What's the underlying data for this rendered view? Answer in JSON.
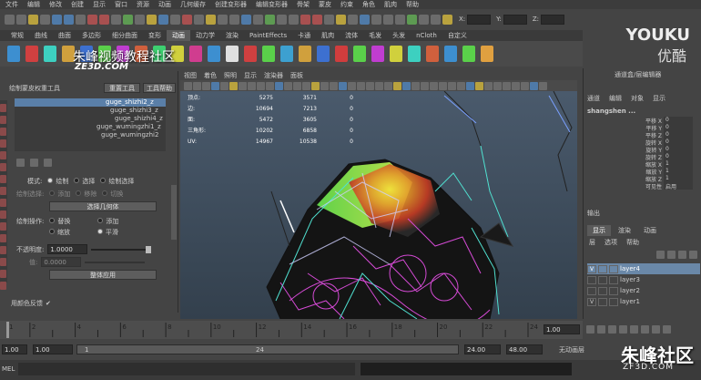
{
  "menubar": [
    "文件",
    "编辑",
    "修改",
    "创建",
    "显示",
    "窗口",
    "资源",
    "动画",
    "几何缓存",
    "创建变形器",
    "编辑变形器",
    "骨架",
    "蒙皮",
    "约束",
    "角色",
    "肌肉",
    "帮助"
  ],
  "status": {
    "x_label": "X:",
    "y_label": "Y:",
    "z_label": "Z:"
  },
  "shelf_tabs": [
    "常规",
    "曲线",
    "曲面",
    "多边形",
    "细分曲面",
    "变形",
    "动画",
    "动力学",
    "渲染",
    "PaintEffects",
    "卡通",
    "肌肉",
    "流体",
    "毛发",
    "头发",
    "nCloth",
    "自定义"
  ],
  "shelf_active": 6,
  "watermarks": {
    "youku": "YOUKU",
    "youku_cn": "优酷",
    "community": "朱峰视频教程社区",
    "ze3d": "ZE3D.COM",
    "community2": "朱峰社区",
    "zf3d": "ZF3D.COM"
  },
  "toolpanel": {
    "title": "绘制蒙皮权重工具",
    "reset": "重置工具",
    "help": "工具帮助",
    "bones": [
      "guge_shizhi2_z",
      "guge_shizhi3_z",
      "guge_shizhi4_z",
      "guge_wumingzhi1_z",
      "guge_wumingzhi2"
    ],
    "mode_label": "模式:",
    "mode_paint": "绘制",
    "mode_select": "选择",
    "mode_paintsel": "绘制选择",
    "paintsel_label": "绘制选择:",
    "add": "添加",
    "remove": "移除",
    "toggle": "切换",
    "select_geo": "选择几何体",
    "op_label": "绘制操作:",
    "replace": "替换",
    "add2": "添加",
    "scale": "缩放",
    "smooth": "平滑",
    "opacity_label": "不透明度:",
    "opacity_value": "1.0000",
    "value_label": "值:",
    "value_value": "0.0000",
    "flood": "整体应用",
    "colorfeedback": "用颜色反馈"
  },
  "viewport_menu": [
    "视图",
    "着色",
    "照明",
    "显示",
    "渲染器",
    "面板"
  ],
  "hud": {
    "rows": [
      {
        "name": "顶点:",
        "a": "5275",
        "b": "3571",
        "c": "0"
      },
      {
        "name": "边:",
        "a": "10694",
        "b": "7213",
        "c": "0"
      },
      {
        "name": "面:",
        "a": "5472",
        "b": "3605",
        "c": "0"
      },
      {
        "name": "三角形:",
        "a": "10202",
        "b": "6858",
        "c": "0"
      },
      {
        "name": "UV:",
        "a": "14967",
        "b": "10538",
        "c": "0"
      }
    ]
  },
  "channelbox": {
    "title": "通道盒/层编辑器",
    "menu": [
      "通道",
      "编辑",
      "对象",
      "显示"
    ],
    "object": "shangshen ...",
    "attrs": [
      {
        "n": "平移 X",
        "v": "0"
      },
      {
        "n": "平移 Y",
        "v": "0"
      },
      {
        "n": "平移 Z",
        "v": "0"
      },
      {
        "n": "旋转 X",
        "v": "0"
      },
      {
        "n": "旋转 Y",
        "v": "0"
      },
      {
        "n": "旋转 Z",
        "v": "0"
      },
      {
        "n": "缩放 X",
        "v": "1"
      },
      {
        "n": "缩放 Y",
        "v": "1"
      },
      {
        "n": "缩放 Z",
        "v": "1"
      },
      {
        "n": "可见性",
        "v": "启用"
      }
    ],
    "history": "输出",
    "tabs": [
      "显示",
      "渲染",
      "动画"
    ],
    "layer_menu": [
      "层",
      "选项",
      "帮助"
    ],
    "layers": [
      {
        "v": "V",
        "name": "layer4",
        "sel": true
      },
      {
        "v": "",
        "name": "layer3",
        "sel": false
      },
      {
        "v": "",
        "name": "layer2",
        "sel": false
      },
      {
        "v": "V",
        "name": "layer1",
        "sel": false
      }
    ]
  },
  "timeline": {
    "ticks": [
      "1",
      "2",
      "4",
      "6",
      "8",
      "10",
      "12",
      "14",
      "16",
      "18",
      "20",
      "22",
      "24"
    ],
    "current": "1.00"
  },
  "range": {
    "start": "1.00",
    "start2": "1.00",
    "slider_start": "1",
    "slider_end": "24",
    "end": "24.00",
    "end2": "48.00",
    "anim_layer": "无动画层"
  },
  "cmd": {
    "label": "MEL"
  }
}
